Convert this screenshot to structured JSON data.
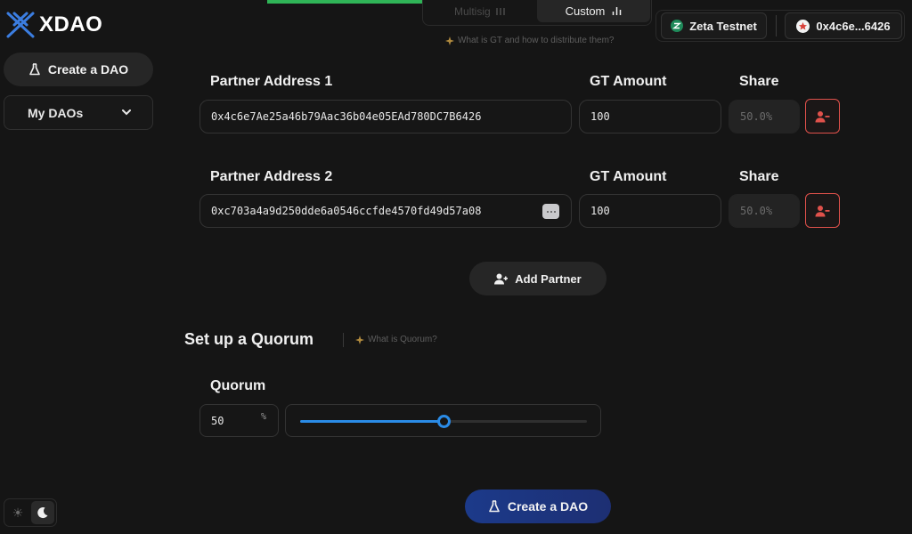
{
  "brand": {
    "name": "XDAO",
    "accent": "#2a8be6"
  },
  "sidebar": {
    "create_label": "Create a DAO",
    "create_icon": "flask-icon",
    "my_daos_label": "My DAOs",
    "my_daos_icon": "chevron-down-icon"
  },
  "tabs": {
    "multisig_label": "Multisig",
    "multisig_icon": "bars-icon",
    "custom_label": "Custom",
    "custom_icon": "bar-chart-icon"
  },
  "hints": {
    "gt": "What is GT and how to distribute them?",
    "quorum": "What is Quorum?"
  },
  "network": {
    "name": "Zeta Testnet",
    "account": "0x4c6e...6426"
  },
  "partners": {
    "gt_label": "GT Amount",
    "share_label": "Share",
    "rows": [
      {
        "label": "Partner Address 1",
        "address": "0x4c6e7Ae25a46b79Aac36b04e05EAd780DC7B6426",
        "gt": "100",
        "share": "50.0%"
      },
      {
        "label": "Partner Address 2",
        "address": "0xc703a4a9d250dde6a0546ccfde4570fd49d57a08",
        "gt": "100",
        "share": "50.0%"
      }
    ],
    "add_label": "Add Partner"
  },
  "quorum": {
    "section_title": "Set up a Quorum",
    "label": "Quorum",
    "value": "50",
    "unit": "%",
    "slider_percent": 50
  },
  "submit": {
    "label": "Create a DAO"
  },
  "theme": {
    "light_icon": "sun-icon",
    "dark_icon": "moon-icon",
    "active": "dark"
  }
}
